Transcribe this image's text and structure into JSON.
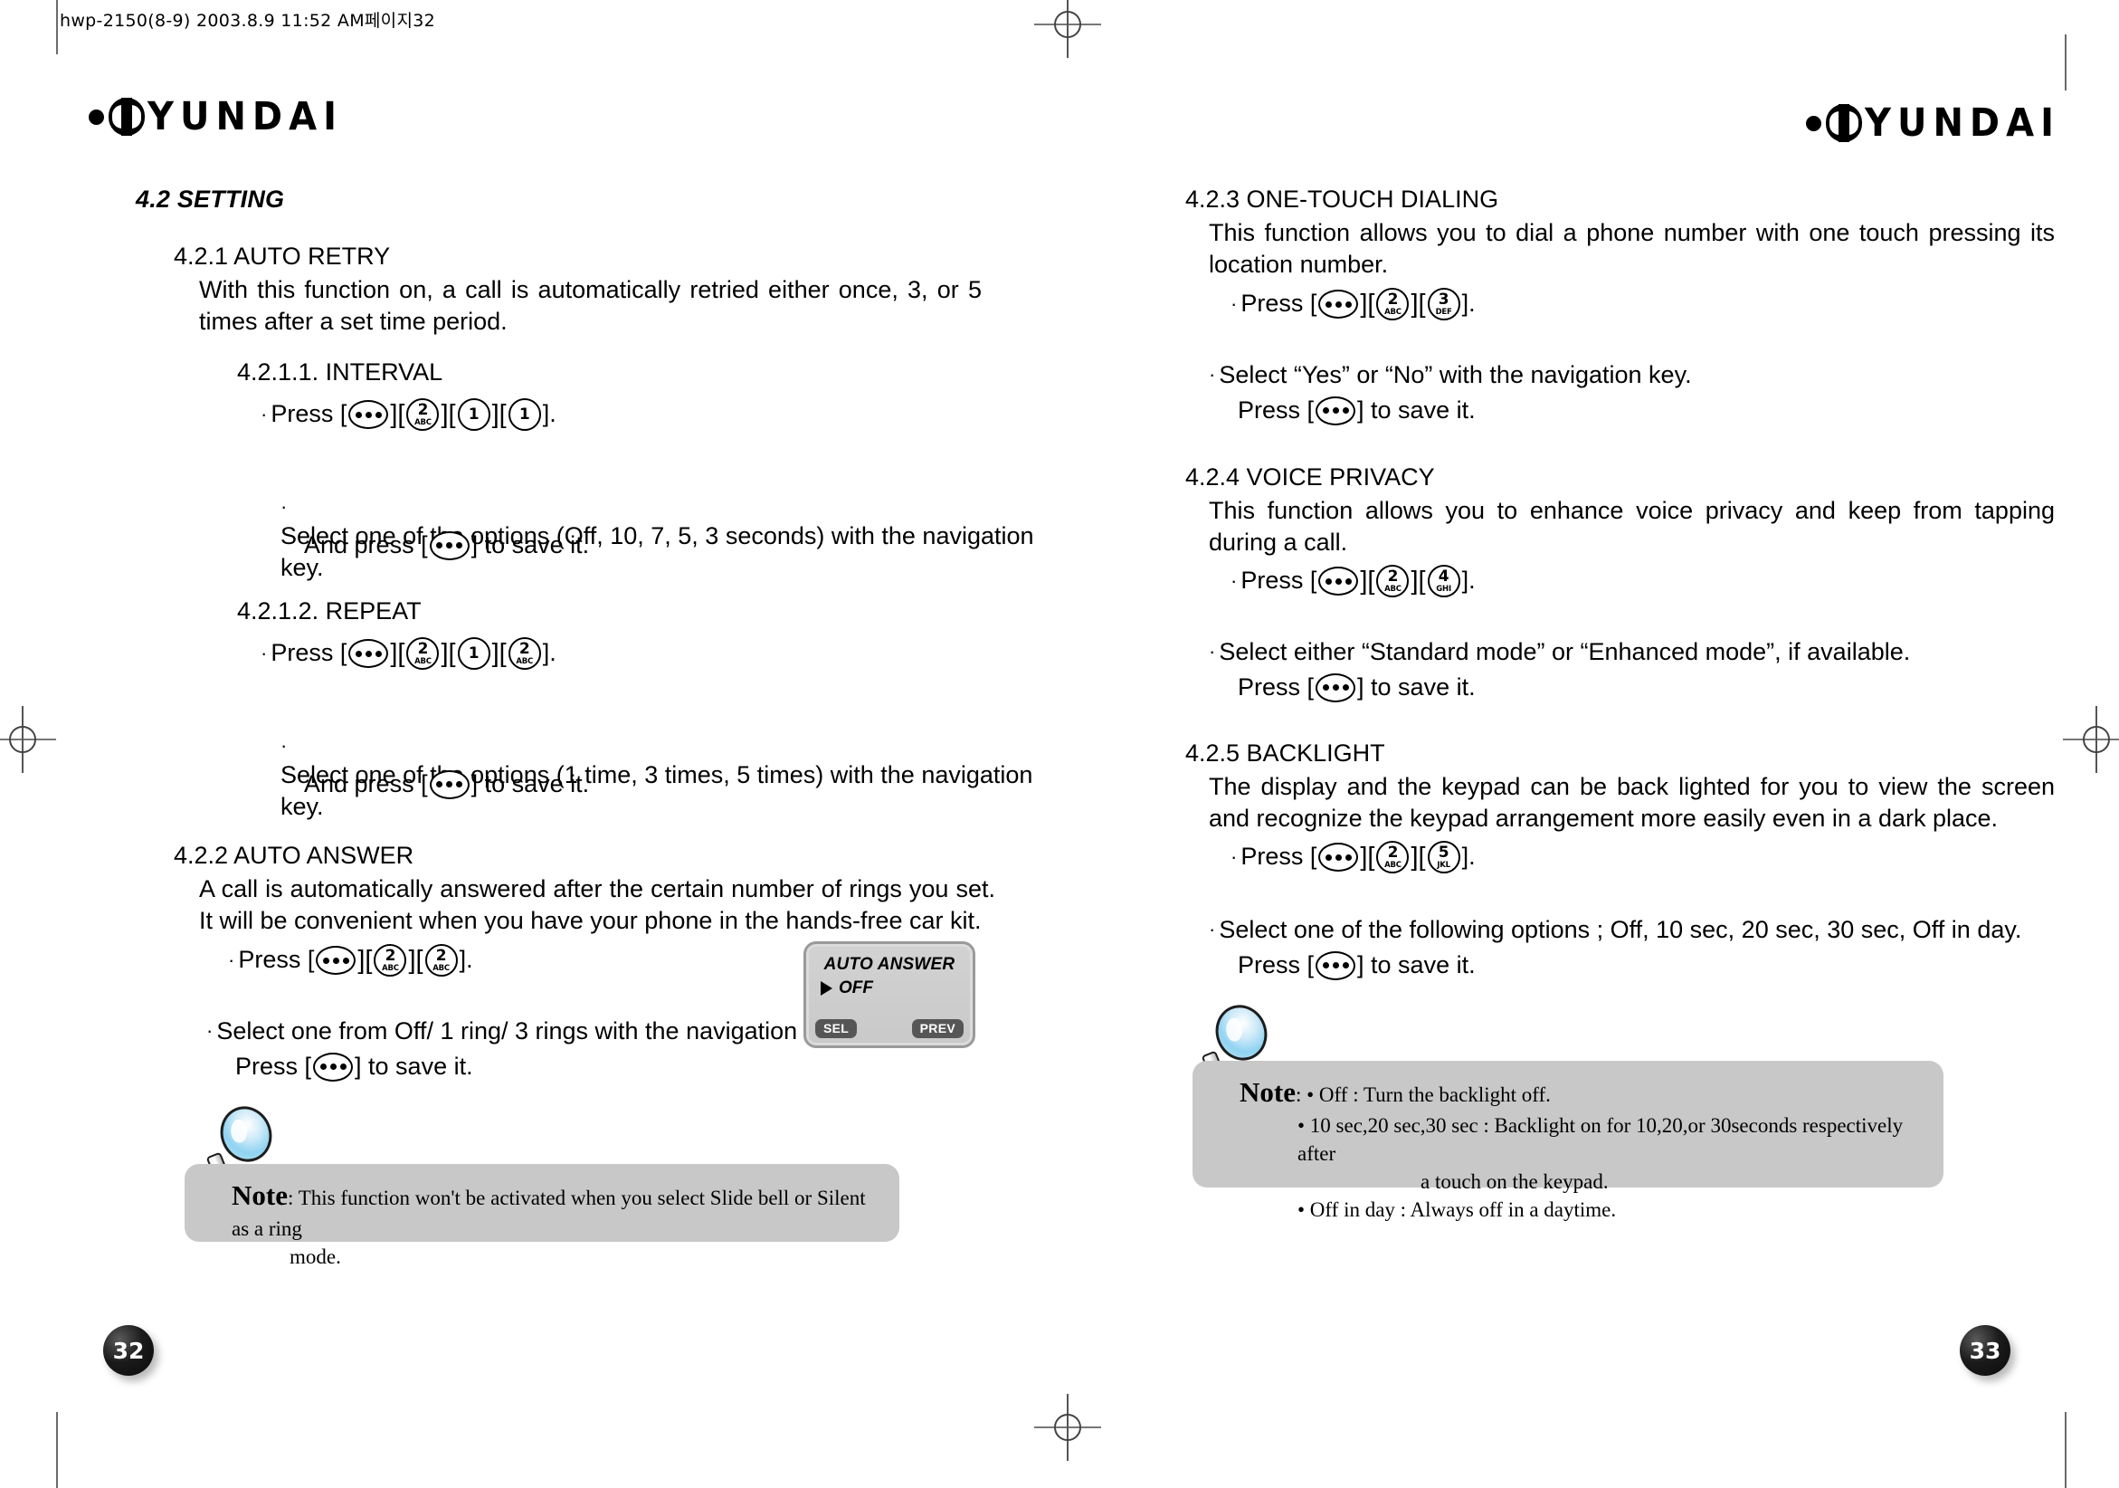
{
  "slug": "hwp-2150(8-9)  2003.8.9 11:52 AM페이지32",
  "brand": {
    "wordmark": "YUNDAI"
  },
  "page_numbers": {
    "left": "32",
    "right": "33"
  },
  "left_page": {
    "section_title": "4.2 SETTING",
    "blocks": [
      {
        "heading": "4.2.1 AUTO RETRY",
        "body": "With this function on, a call is automatically retried either once, 3, or 5 times after a set time period."
      },
      {
        "subheading": "4.2.1.1. INTERVAL",
        "press_prefix": "Press [",
        "press_suffix": "].",
        "keys": [
          "menu",
          "2",
          "1",
          "1"
        ],
        "select_line": "Select one of the options (Off, 10, 7, 5, 3 seconds) with the navigation key.",
        "save_prefix": "And press [",
        "save_suffix": "] to save it.",
        "save_key": "menu"
      },
      {
        "subheading": "4.2.1.2. REPEAT",
        "press_prefix": "Press [",
        "press_suffix": "].",
        "keys": [
          "menu",
          "2",
          "1",
          "2"
        ],
        "select_line": "Select one of the options (1 time, 3 times, 5 times) with the navigation key.",
        "save_prefix": "And press [",
        "save_suffix": "] to save it.",
        "save_key": "menu"
      },
      {
        "heading": "4.2.2 AUTO ANSWER",
        "body": "A call is automatically answered after the certain number of rings you set. It will be convenient when you have your phone in the hands-free car kit.",
        "press_prefix": "Press [",
        "press_suffix": "].",
        "keys": [
          "menu",
          "2",
          "2"
        ],
        "select_line": "Select one from Off/ 1 ring/ 3 rings with the navigation key.",
        "save_prefix": "Press [",
        "save_suffix": "] to save it.",
        "save_key": "menu"
      }
    ],
    "lcd": {
      "title": "AUTO ANSWER",
      "value": "OFF",
      "softkey_left": "SEL",
      "softkey_right": "PREV"
    },
    "note": {
      "label": "Note",
      "colon": ":",
      "lines": [
        "This function won't be activated when you select Slide bell or Silent as a ring",
        "mode."
      ]
    }
  },
  "right_page": {
    "blocks": [
      {
        "heading": "4.2.3 ONE-TOUCH DIALING",
        "body": "This function allows you to dial a phone number with one touch pressing its location number.",
        "press_prefix": "Press [",
        "press_suffix": "].",
        "keys": [
          "menu",
          "2",
          "3"
        ],
        "select_line": "Select “Yes” or “No” with the navigation key.",
        "save_prefix": "Press [",
        "save_suffix": "] to save it.",
        "save_key": "menu"
      },
      {
        "heading": "4.2.4 VOICE PRIVACY",
        "body": "This function allows you to enhance voice privacy and keep from tapping during a call.",
        "press_prefix": "Press [",
        "press_suffix": "].",
        "keys": [
          "menu",
          "2",
          "4"
        ],
        "select_line": "Select either “Standard mode” or “Enhanced mode”, if available.",
        "save_prefix": "Press [",
        "save_suffix": "] to save it.",
        "save_key": "menu"
      },
      {
        "heading": "4.2.5 BACKLIGHT",
        "body": "The display and the keypad can be back lighted for you to view the screen and recognize the keypad arrangement more easily even in a dark place.",
        "press_prefix": "Press [",
        "press_suffix": "].",
        "keys": [
          "menu",
          "2",
          "5"
        ],
        "select_line": "Select one of the following options ; Off, 10 sec, 20 sec, 30 sec, Off in day.",
        "save_prefix": "Press [",
        "save_suffix": "] to save it.",
        "save_key": "menu"
      }
    ],
    "note": {
      "label": "Note",
      "colon": ":",
      "lines": [
        "• Off : Turn the backlight off.",
        "• 10 sec,20 sec,30 sec : Backlight on for 10,20,or 30seconds respectively after",
        "a touch on the keypad.",
        "• Off in day : Always off in a daytime."
      ]
    }
  },
  "keypad_glyphs": {
    "menu": {
      "type": "dots",
      "label": "menu-key"
    },
    "1": {
      "num": "1",
      "sub": ""
    },
    "2": {
      "num": "2",
      "sub": "ABC"
    },
    "3": {
      "num": "3",
      "sub": "DEF"
    },
    "4": {
      "num": "4",
      "sub": "GHI"
    },
    "5": {
      "num": "5",
      "sub": "JKL"
    }
  }
}
